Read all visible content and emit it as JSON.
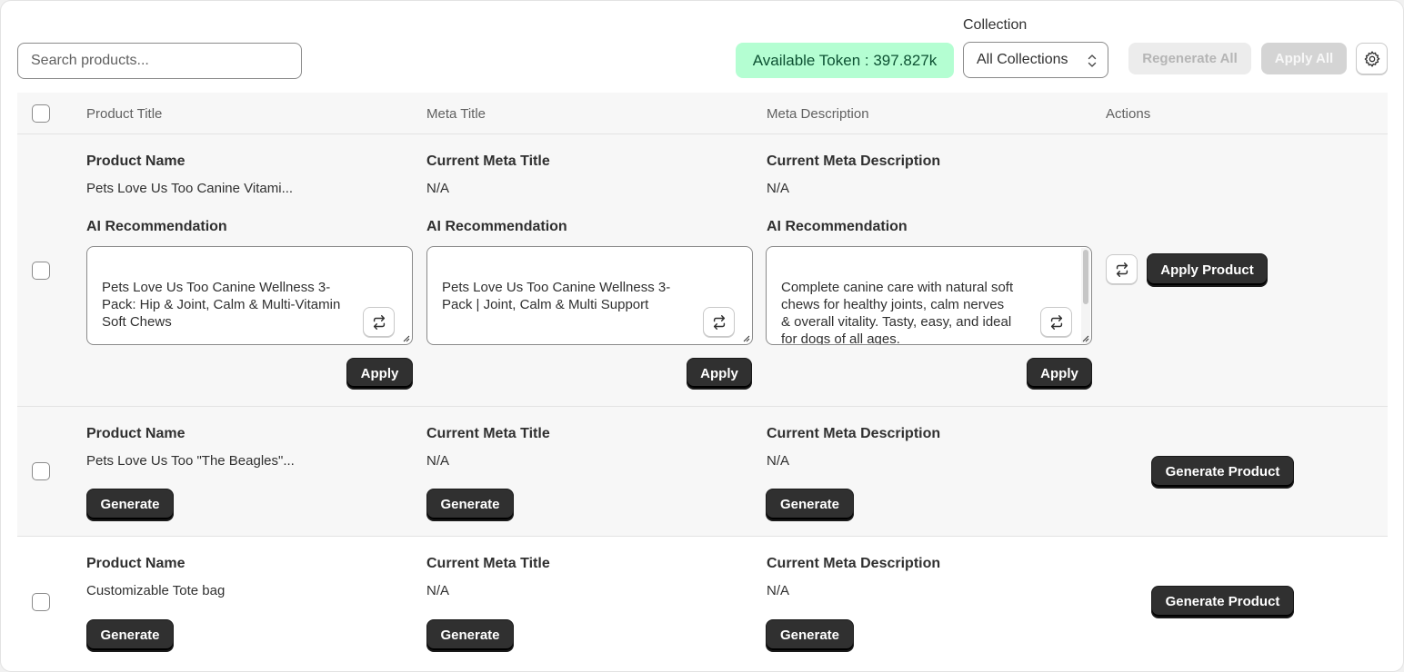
{
  "toolbar": {
    "search_placeholder": "Search products...",
    "token_text": "Available Token : 397.827k",
    "collection_label": "Collection",
    "collection_value": "All Collections",
    "regenerate_all": "Regenerate All",
    "apply_all": "Apply All"
  },
  "table": {
    "headers": [
      "Product Title",
      "Meta Title",
      "Meta Description",
      "Actions"
    ]
  },
  "rows": [
    {
      "product_label": "Product Name",
      "product_name": "Pets Love Us Too Canine Vitami...",
      "meta_title_label": "Current Meta Title",
      "meta_title": "N/A",
      "meta_desc_label": "Current Meta Description",
      "meta_desc": "N/A",
      "ai_label": "AI Recommendation",
      "ai_title": "Pets Love Us Too Canine Wellness 3-\nPack: Hip & Joint, Calm & Multi-Vitamin\nSoft Chews",
      "ai_meta_title": "Pets Love Us Too Canine Wellness 3-\nPack | Joint, Calm & Multi Support",
      "ai_meta_desc": "Complete canine care with natural soft\nchews for healthy joints, calm nerves\n& overall vitality. Tasty, easy, and ideal\nfor dogs of all ages.",
      "apply_label": "Apply",
      "apply_product_label": "Apply Product"
    },
    {
      "product_label": "Product Name",
      "product_name": "Pets Love Us Too \"The Beagles\"...",
      "meta_title_label": "Current Meta Title",
      "meta_title": "N/A",
      "meta_desc_label": "Current Meta Description",
      "meta_desc": "N/A",
      "generate_label": "Generate",
      "generate_product_label": "Generate Product"
    },
    {
      "product_label": "Product Name",
      "product_name": "Customizable Tote bag",
      "meta_title_label": "Current Meta Title",
      "meta_title": "N/A",
      "meta_desc_label": "Current Meta Description",
      "meta_desc": "N/A",
      "generate_label": "Generate",
      "generate_product_label": "Generate Product"
    }
  ]
}
